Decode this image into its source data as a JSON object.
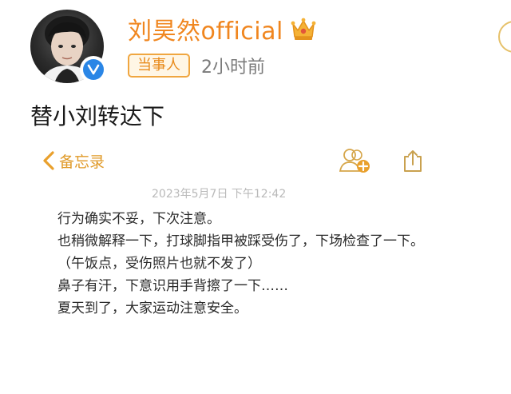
{
  "post": {
    "username": "刘昊然official",
    "tag": "当事人",
    "time": "2小时前",
    "text": "替小刘转达下"
  },
  "icons": {
    "crown": "crown-icon",
    "verified": "verified-v-icon",
    "back": "chevron-left-icon",
    "share_user": "add-collaborator-icon",
    "export": "share-export-icon"
  },
  "memo": {
    "back_label": "备忘录",
    "date": "2023年5月7日 下午12:42",
    "lines": [
      "行为确实不妥，下次注意。",
      "也稍微解释一下，打球脚指甲被踩受伤了，下场检查了一下。（午饭点，受伤照片也就不发了）",
      "鼻子有汗，下意识用手背擦了一下……",
      "夏天到了，大家运动注意安全。"
    ]
  },
  "colors": {
    "username": "#f0861f",
    "tag_border": "#f0a640",
    "memo_accent": "#e09a28",
    "verified": "#2a86e6"
  }
}
